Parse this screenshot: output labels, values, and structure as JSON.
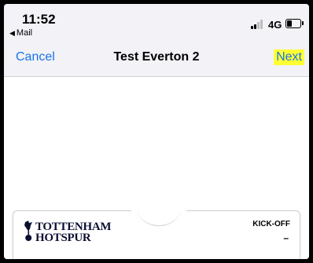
{
  "status_bar": {
    "time": "11:52",
    "back_app": "Mail",
    "network": "4G",
    "signal_bars_filled": 2,
    "signal_bars_total": 4,
    "battery_level": 0.35
  },
  "nav": {
    "cancel_label": "Cancel",
    "title": "Test Everton 2",
    "next_label": "Next",
    "accent_color": "#1a73e8",
    "highlight_color": "#ffff33"
  },
  "pass": {
    "club_name_line1": "TOTTENHAM",
    "club_name_line2": "HOTSPUR",
    "kickoff_label": "KICK-OFF",
    "kickoff_value": "–",
    "brand_color": "#0b1033"
  }
}
